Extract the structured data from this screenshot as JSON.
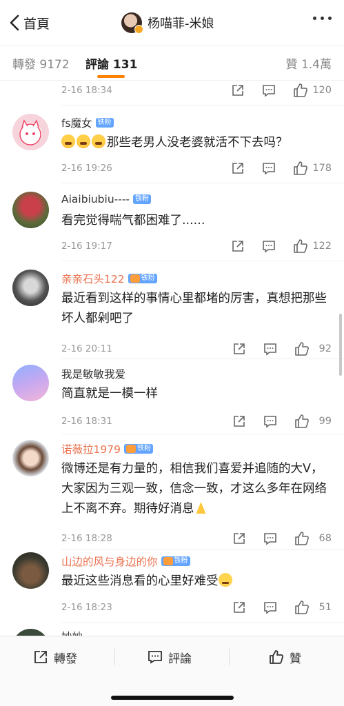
{
  "header": {
    "back_label": "首頁",
    "title": "杨喵菲-米娘"
  },
  "tabs": {
    "repost": "轉發 9172",
    "comment": "評論 131",
    "like": "贊 1.4萬"
  },
  "colors": {
    "accent": "#ff8200",
    "name_orange": "#eb7350",
    "badge_blue": "#63a4ff"
  },
  "comments": [
    {
      "name": "",
      "badge": "",
      "text": "",
      "time": "2-16 18:34",
      "likes": "120"
    },
    {
      "name": "fs魔女",
      "badge": "铁粉",
      "text": "那些老男人没老婆就活不下去吗？",
      "emojis": [
        "angry",
        "angry",
        "angry"
      ],
      "time": "2-16 19:26",
      "likes": "178"
    },
    {
      "name": "Aiaibiubiu----",
      "badge": "铁粉",
      "text": "看完觉得喘气都困难了......",
      "time": "2-16 19:17",
      "likes": "122"
    },
    {
      "name": "亲亲石头122",
      "badge": "铁粉",
      "text": "最近看到这样的事情心里都堵的厉害，真想把那些坏人都剁吧了",
      "time": "2-16 20:11",
      "likes": "92"
    },
    {
      "name": "我是敏敏我爱",
      "badge": "",
      "text": "简直就是一模一样",
      "time": "2-16 18:31",
      "likes": "99"
    },
    {
      "name": "诺薇拉1979",
      "badge": "铁粉",
      "text": "微博还是有力量的，相信我们喜爱并追随的大V，大家因为三观一致，信念一致，才这么多年在网络上不离不弃。期待好消息",
      "emoji_end": "pray-icon",
      "time": "2-16 18:28",
      "likes": "68"
    },
    {
      "name": "山边的风与身边的你",
      "badge": "铁粉",
      "text": "最近这些消息看的心里好难受",
      "emoji_end": "sad-face-icon",
      "time": "2-16 18:23",
      "likes": "51"
    },
    {
      "name": "妙妙",
      "badge": "",
      "text": "",
      "time": "",
      "likes": ""
    }
  ],
  "bottom_bar": {
    "repost": "轉發",
    "comment": "評論",
    "like": "贊"
  }
}
